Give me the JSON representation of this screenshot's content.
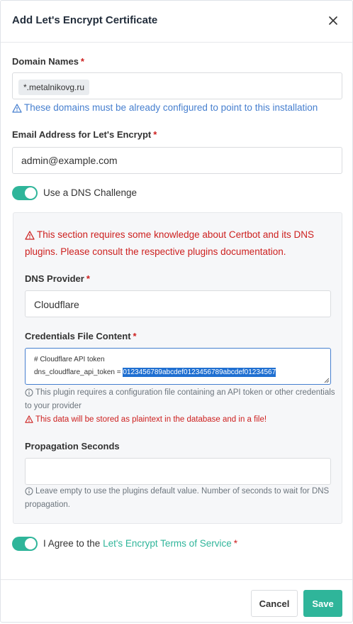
{
  "dialog": {
    "title": "Add Let's Encrypt Certificate",
    "close_icon": "close-icon"
  },
  "domain_names": {
    "label": "Domain Names",
    "required_mark": "*",
    "tags": [
      "*.metalnikovg.ru"
    ],
    "hint": "These domains must be already configured to point to this installation"
  },
  "email": {
    "label": "Email Address for Let's Encrypt",
    "required_mark": "*",
    "value": "admin@example.com"
  },
  "dns_challenge": {
    "label": "Use a DNS Challenge",
    "enabled": true
  },
  "dns_section": {
    "warning": "This section requires some knowledge about Certbot and its DNS plugins. Please consult the respective plugins documentation.",
    "provider_label": "DNS Provider",
    "provider_required_mark": "*",
    "provider_value": "Cloudflare",
    "credentials_label": "Credentials File Content",
    "credentials_required_mark": "*",
    "credentials_line1": "# Cloudflare API token",
    "credentials_line2_prefix": "dns_cloudflare_api_token = ",
    "credentials_line2_selected": "0123456789abcdef0123456789abcdef01234567",
    "credentials_hint": "This plugin requires a configuration file containing an API token or other credentials to your provider",
    "credentials_warning": "This data will be stored as plaintext in the database and in a file!",
    "propagation_label": "Propagation Seconds",
    "propagation_value": "",
    "propagation_hint": "Leave empty to use the plugins default value. Number of seconds to wait for DNS propagation."
  },
  "agree": {
    "enabled": true,
    "prefix": "I Agree to the ",
    "link_text": "Let's Encrypt Terms of Service",
    "required_mark": "*"
  },
  "footer": {
    "cancel_label": "Cancel",
    "save_label": "Save"
  },
  "colors": {
    "accent": "#2fb59a",
    "info_blue": "#467fcf",
    "danger_red": "#cd201f"
  }
}
